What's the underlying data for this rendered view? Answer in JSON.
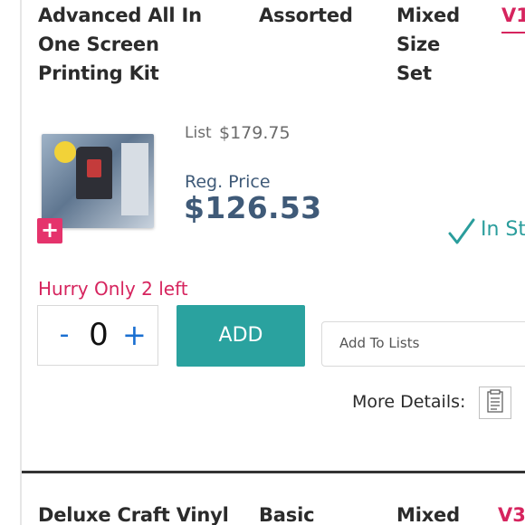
{
  "product_row_1": {
    "name": "Advanced All In One Screen Printing Kit",
    "color": "Assorted",
    "size": "Mixed Size Set",
    "sku_link": "V1",
    "list_label": "List",
    "list_price": "$179.75",
    "reg_price_label": "Reg. Price",
    "reg_price": "$126.53",
    "stock_status": "In St",
    "hurry_message": "Hurry Only 2 left",
    "quantity": "0",
    "qty_minus": "-",
    "qty_plus": "+",
    "add_button": "ADD",
    "add_to_lists": "Add To Lists",
    "more_details": "More Details:",
    "add_image_icon": "+"
  },
  "product_row_2": {
    "name": "Deluxe Craft Vinyl",
    "color": "Basic",
    "size": "Mixed",
    "sku_link": "V3"
  },
  "colors": {
    "accent_pink": "#d6245e",
    "price_blue": "#3f5a78",
    "teal": "#2aa29f",
    "stepper_blue": "#1a6fd1"
  },
  "icons": {
    "stock": "checkmark-icon",
    "details": "document-icon",
    "add_image": "plus-icon"
  }
}
